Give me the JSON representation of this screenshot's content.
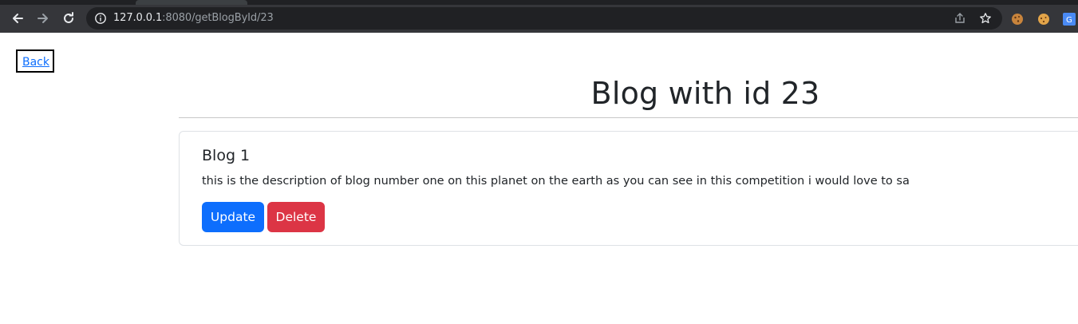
{
  "browser": {
    "url_host": "127.0.0.1",
    "url_rest": ":8080/getBlogById/23",
    "icons": {
      "back": "arrow-left-icon",
      "forward": "arrow-right-icon",
      "reload": "reload-icon",
      "site_info": "info-icon",
      "share": "share-icon",
      "bookmark": "star-icon",
      "extension_1": "cookie-icon",
      "extension_2": "cookie-icon",
      "extension_3": "translate-icon"
    }
  },
  "page": {
    "back_link": "Back",
    "title": "Blog with id 23",
    "blog": {
      "title": "Blog 1",
      "description": "this is the description of blog number one on this planet on the earth as you can see in this competition i would love to sa",
      "update_label": "Update",
      "delete_label": "Delete"
    }
  },
  "colors": {
    "link": "#0d6efd",
    "update_button": "#0d6efd",
    "delete_button": "#dc3545",
    "text": "#212529",
    "toolbar": "#35363a"
  }
}
